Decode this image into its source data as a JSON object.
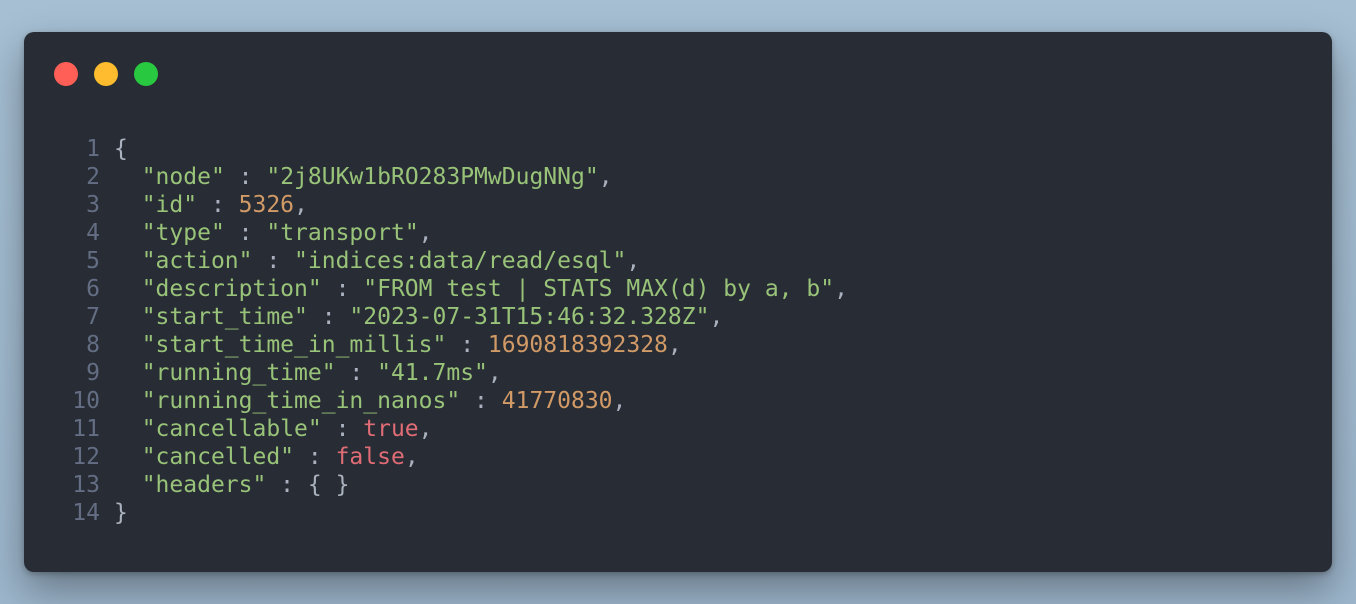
{
  "window": {
    "buttons": [
      {
        "name": "close",
        "color": "#ff5f57"
      },
      {
        "name": "minimize",
        "color": "#febc2e"
      },
      {
        "name": "maximize",
        "color": "#28c840"
      }
    ]
  },
  "code": {
    "lines": [
      {
        "n": "1",
        "open": "{"
      },
      {
        "n": "2",
        "key": "\"node\"",
        "sep": " : ",
        "value": "\"2j8UKw1bRO283PMwDugNNg\"",
        "vtype": "str",
        "trail": ","
      },
      {
        "n": "3",
        "key": "\"id\"",
        "sep": " : ",
        "value": "5326",
        "vtype": "num",
        "trail": ","
      },
      {
        "n": "4",
        "key": "\"type\"",
        "sep": " : ",
        "value": "\"transport\"",
        "vtype": "str",
        "trail": ","
      },
      {
        "n": "5",
        "key": "\"action\"",
        "sep": " : ",
        "value": "\"indices:data/read/esql\"",
        "vtype": "str",
        "trail": ","
      },
      {
        "n": "6",
        "key": "\"description\"",
        "sep": " : ",
        "value": "\"FROM test | STATS MAX(d) by a, b\"",
        "vtype": "str",
        "trail": ","
      },
      {
        "n": "7",
        "key": "\"start_time\"",
        "sep": " : ",
        "value": "\"2023-07-31T15:46:32.328Z\"",
        "vtype": "str",
        "trail": ","
      },
      {
        "n": "8",
        "key": "\"start_time_in_millis\"",
        "sep": " : ",
        "value": "1690818392328",
        "vtype": "num",
        "trail": ","
      },
      {
        "n": "9",
        "key": "\"running_time\"",
        "sep": " : ",
        "value": "\"41.7ms\"",
        "vtype": "str",
        "trail": ","
      },
      {
        "n": "10",
        "key": "\"running_time_in_nanos\"",
        "sep": " : ",
        "value": "41770830",
        "vtype": "num",
        "trail": ","
      },
      {
        "n": "11",
        "key": "\"cancellable\"",
        "sep": " : ",
        "value": "true",
        "vtype": "bool",
        "trail": ","
      },
      {
        "n": "12",
        "key": "\"cancelled\"",
        "sep": " : ",
        "value": "false",
        "vtype": "bool",
        "trail": ","
      },
      {
        "n": "13",
        "key": "\"headers\"",
        "sep": " : ",
        "value": "{ }",
        "vtype": "punc",
        "trail": ""
      },
      {
        "n": "14",
        "open": "}"
      }
    ]
  }
}
